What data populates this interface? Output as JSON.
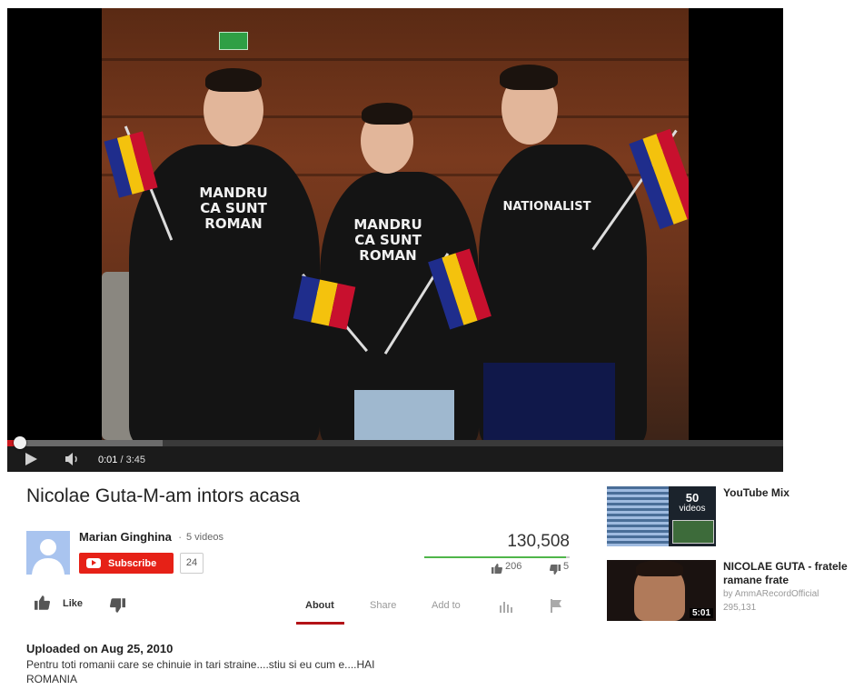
{
  "player": {
    "time_current": "0:01",
    "time_separator": " / ",
    "time_total": "3:45",
    "progress_fraction": 0.005,
    "buffered_fraction": 0.2,
    "shirt_texts": {
      "left": "MANDRU\nCA SUNT\nROMAN",
      "middle": "MANDRU\nCA SUNT\nROMAN",
      "right": "NATIONALIST"
    }
  },
  "video": {
    "title": "Nicolae Guta-M-am intors acasa",
    "view_count": "130,508",
    "likes": "206",
    "dislikes": "5",
    "like_fraction": 0.976
  },
  "channel": {
    "name": "Marian Ginghina",
    "dot": "·",
    "video_count": "5 videos",
    "subscribe_label": "Subscribe",
    "subscriber_count": "24"
  },
  "actions": {
    "like_label": "Like",
    "tabs": {
      "about": "About",
      "share": "Share",
      "add_to": "Add to"
    }
  },
  "description": {
    "upload_date": "Uploaded on Aug 25, 2010",
    "text": "Pentru toti romanii care se chinuie in tari straine....stiu si eu cum e....HAI ROMANIA"
  },
  "sidebar": {
    "mix": {
      "title": "YouTube Mix",
      "count": "50",
      "count_label": "videos"
    },
    "related": {
      "title": "NICOLAE GUTA - fratele ramane frate",
      "byline": "by AmmARecordOfficial",
      "views": "295,131",
      "duration": "5:01"
    }
  },
  "colors": {
    "subscribe_red": "#e62117",
    "progress_red": "#cc181e",
    "like_green": "#4fb64a",
    "flag_blue": "#1f2d8c",
    "flag_yellow": "#f4c20d",
    "flag_red": "#c8102e"
  }
}
